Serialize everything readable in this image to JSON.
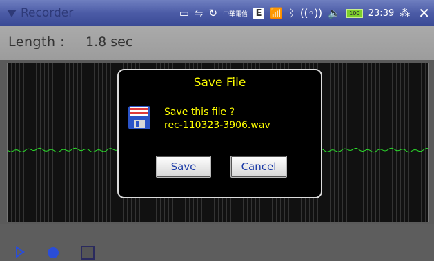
{
  "statusbar": {
    "app_title": "Recorder",
    "carrier": "中華電信",
    "network_badge": "E",
    "battery_text": "100",
    "time": "23:39",
    "icons": [
      "screen-icon",
      "usb-icon",
      "sync-icon",
      "carrier-logo-icon",
      "signal-icon",
      "bluetooth-off-icon",
      "wifi-off-icon",
      "volume-icon",
      "battery-icon",
      "keypad-icon",
      "close-icon"
    ]
  },
  "length_bar": {
    "label": "Length :",
    "value": "1.8 sec"
  },
  "dialog": {
    "title": "Save File",
    "message_line1": "Save this file ?",
    "message_line2": "rec-110323-3906.wav",
    "save_label": "Save",
    "cancel_label": "Cancel"
  },
  "controls": {
    "icons": [
      "play-icon",
      "record-icon",
      "stop-icon"
    ]
  },
  "colors": {
    "status_bar": "#4b5ba6",
    "dialog_text": "#ffff00",
    "button_text": "#1a3aa8",
    "waveform": "#2bdc2b",
    "control_icons": "#2a4dd8"
  }
}
